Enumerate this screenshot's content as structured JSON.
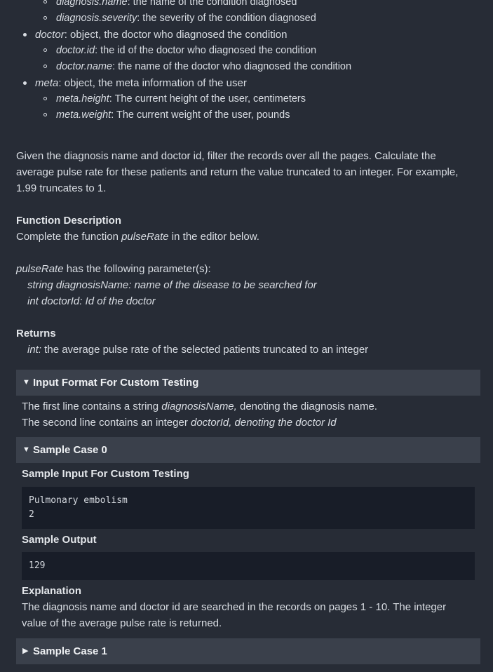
{
  "top_list": [
    {
      "level": 2,
      "term": "diagnosis.name",
      "text": ": the name of the condition diagnosed"
    },
    {
      "level": 2,
      "term": "diagnosis.severity",
      "text": ": the severity of the condition diagnosed"
    },
    {
      "level": 1,
      "term": "doctor",
      "text": ": object, the doctor who diagnosed the condition"
    },
    {
      "level": 2,
      "term": "doctor.id",
      "text": ": the id of the doctor who diagnosed the condition"
    },
    {
      "level": 2,
      "term": "doctor.name",
      "text": ": the name of the doctor who diagnosed the condition"
    },
    {
      "level": 1,
      "term": "meta",
      "text": ": object, the meta information of the user"
    },
    {
      "level": 2,
      "term": "meta.height",
      "text": ": The current height of the user, centimeters"
    },
    {
      "level": 2,
      "term": "meta.weight",
      "text": ": The current weight of the user, pounds"
    }
  ],
  "intro": "Given the diagnosis name and doctor id, filter the records over all the pages. Calculate the average pulse rate for these patients and return the value truncated to an integer. For example, 1.99 truncates to 1.",
  "function_description": {
    "heading": "Function Description",
    "prefix": "Complete the function ",
    "fn": "pulseRate",
    "suffix": " in the editor below."
  },
  "params": {
    "fn": "pulseRate",
    "suffix": " has the following parameter(s):",
    "items": [
      "string diagnosisName: name of the disease to be searched for",
      "int doctorId: Id of the doctor"
    ]
  },
  "returns": {
    "heading": "Returns",
    "type": "int:",
    "text": " the average pulse rate of the selected patients truncated to an integer"
  },
  "input_format": {
    "title": "Input Format For Custom Testing",
    "line1_prefix": "The first line contains a string ",
    "line1_term": "diagnosisName,",
    "line1_suffix": " denoting the diagnosis name.",
    "line2_prefix": "The second line contains an integer ",
    "line2_term": "doctorId, denoting the doctor Id"
  },
  "sample0": {
    "title": "Sample Case 0",
    "input_heading": "Sample Input For Custom Testing",
    "input": "Pulmonary embolism\n2",
    "output_heading": "Sample Output",
    "output": "129",
    "explanation_heading": "Explanation",
    "explanation": "The diagnosis name and doctor id are searched in the records on pages 1 - 10. The integer value of the average pulse rate is returned."
  },
  "sample1": {
    "title": "Sample Case 1"
  }
}
